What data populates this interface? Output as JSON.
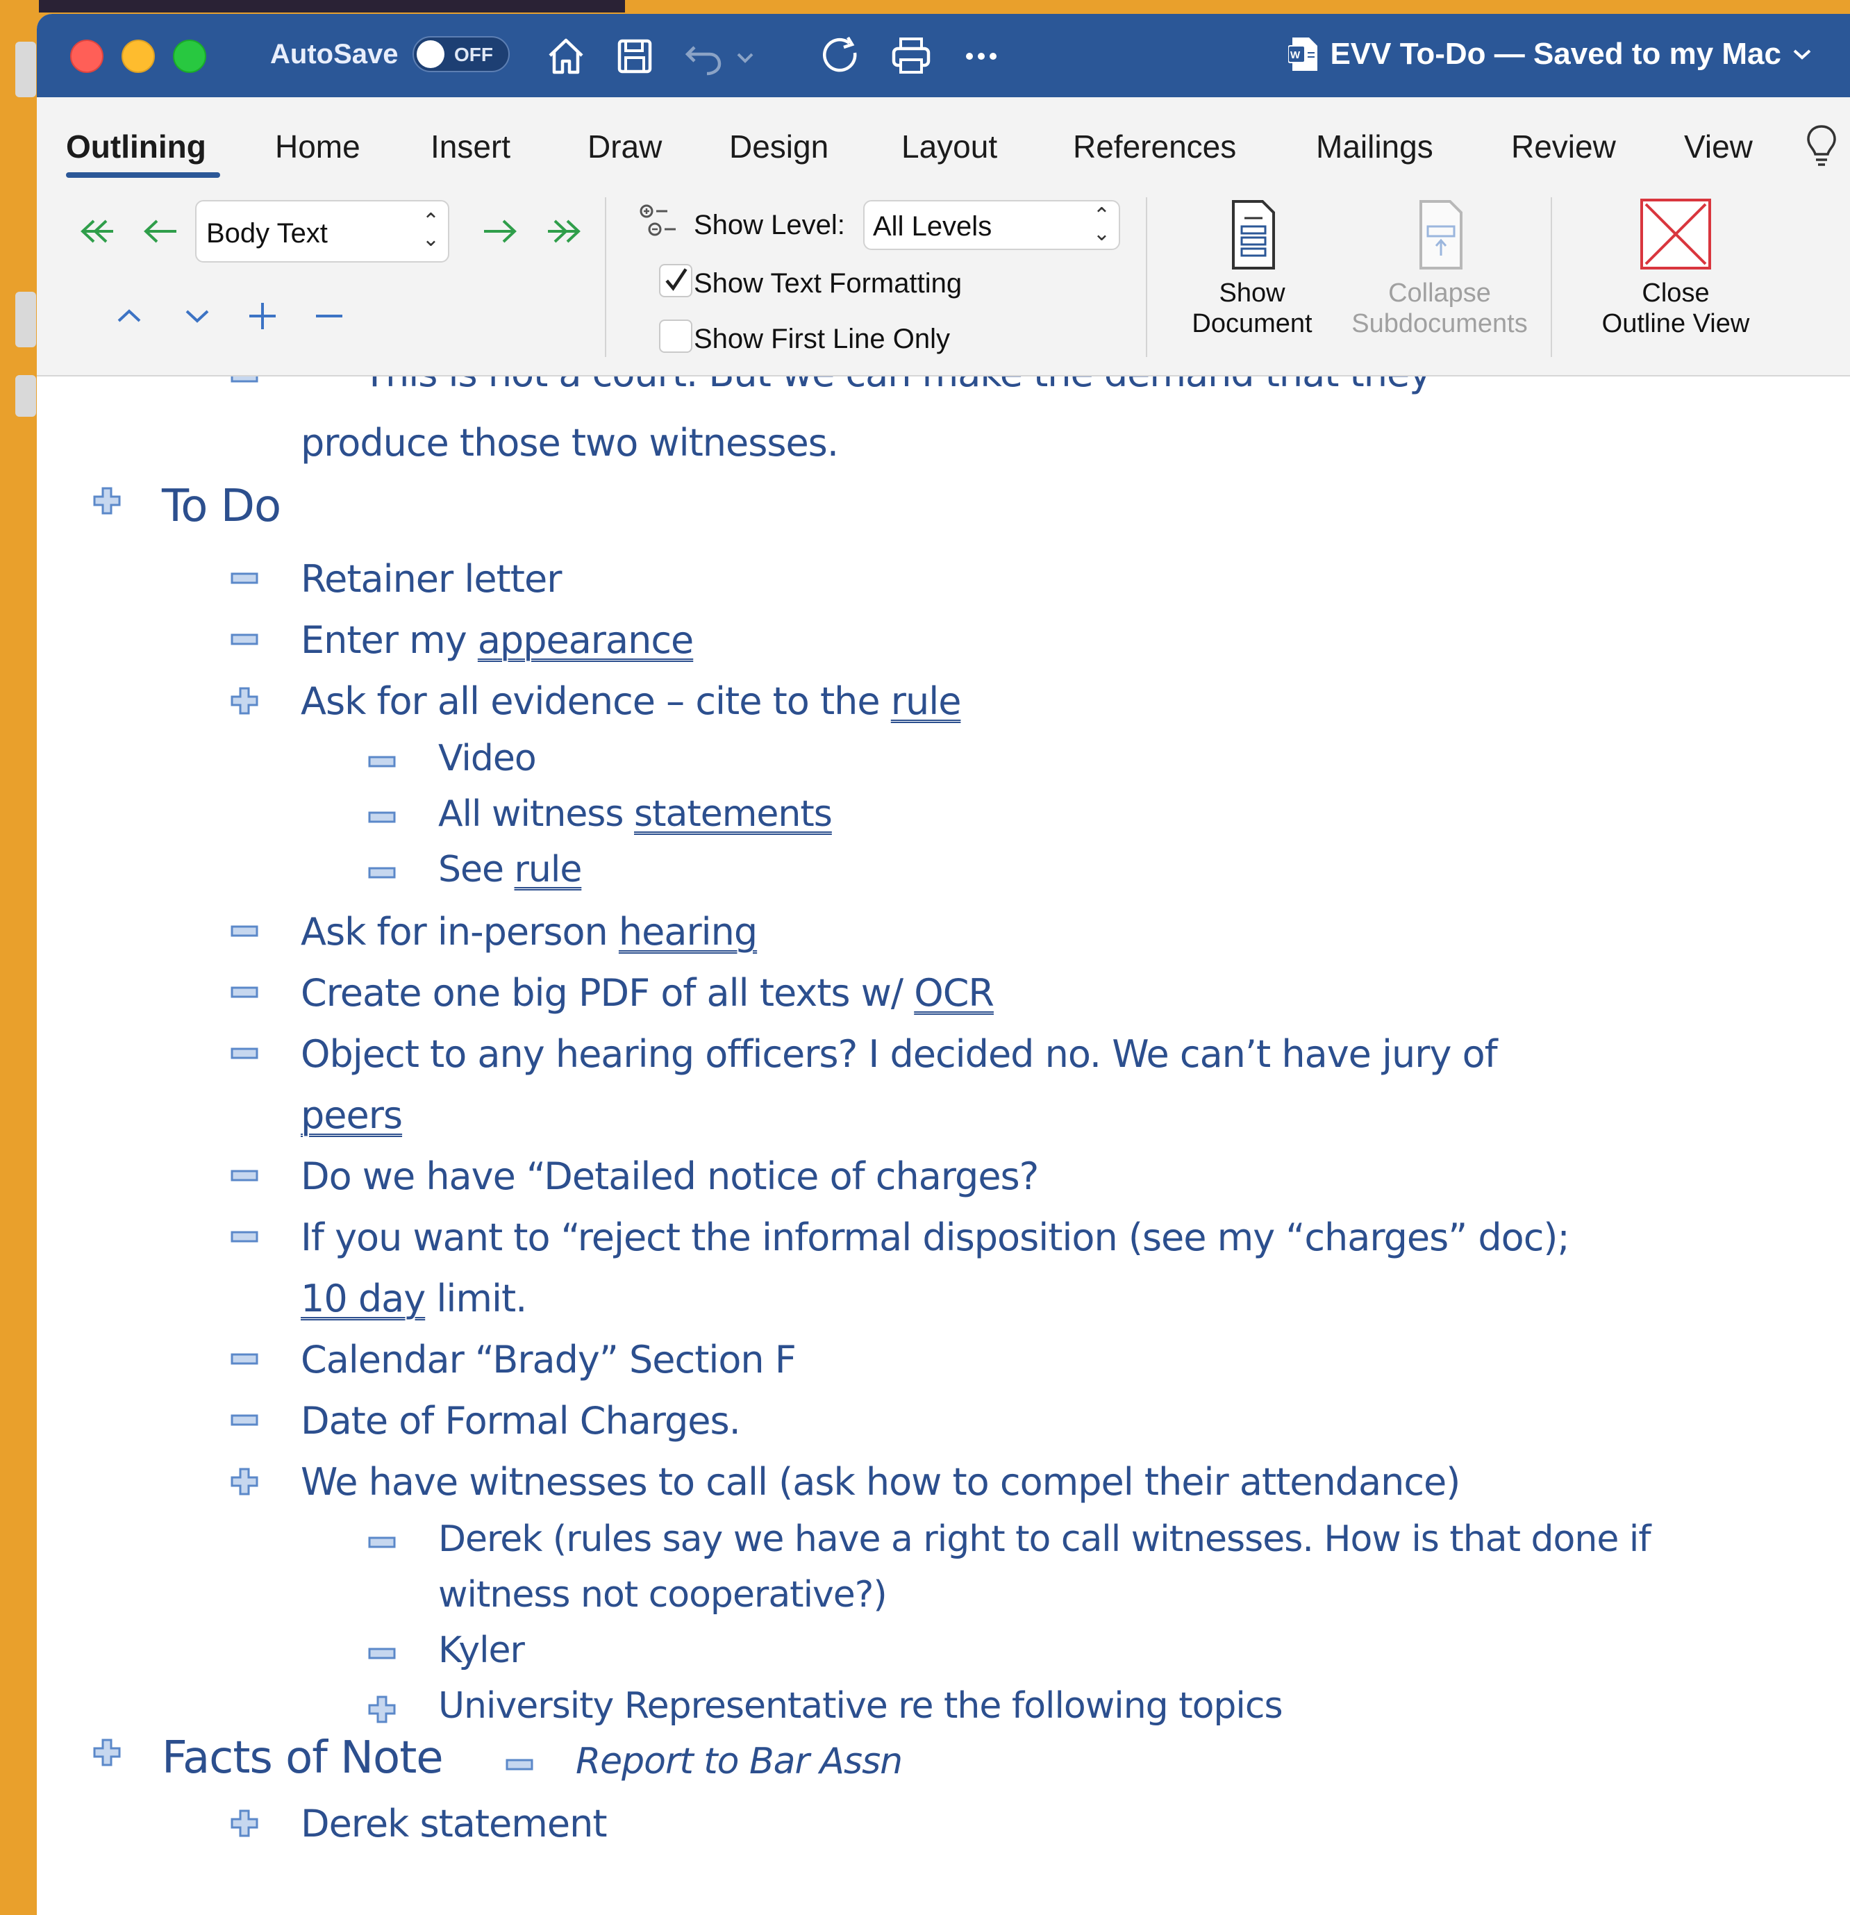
{
  "window": {
    "autosave_label": "AutoSave",
    "autosave_state": "OFF",
    "title": "EVV To-Do — Saved to my Mac",
    "title_chevron": "⌄"
  },
  "tabs": [
    "Outlining",
    "Home",
    "Insert",
    "Draw",
    "Design",
    "Layout",
    "References",
    "Mailings",
    "Review",
    "View"
  ],
  "active_tab": "Outlining",
  "ribbon": {
    "style_value": "Body Text",
    "show_level_label": "Show Level:",
    "show_level_value": "All Levels",
    "show_text_formatting": {
      "label": "Show Text Formatting",
      "checked": true
    },
    "show_first_line_only": {
      "label": "Show First Line Only",
      "checked": false
    },
    "show_document": [
      "Show",
      "Document"
    ],
    "collapse_subdocuments": [
      "Collapse",
      "Subdocuments"
    ],
    "close_outline_view": [
      "Close",
      "Outline View"
    ]
  },
  "colors": {
    "title_bar": "#2b5797",
    "outline_text": "#2c4f8e",
    "accent_green": "#2f9e4a",
    "close_red": "#d9363e"
  },
  "document": {
    "cut_line": "This is not a court.  But we can make the demand that they",
    "cont_line": "produce those two witnesses.",
    "todo_heading": "To Do",
    "items": [
      {
        "pre": "Retainer letter"
      },
      {
        "pre": "Enter my ",
        "link": "appearance"
      },
      {
        "pre": "Ask for all evidence – cite to the ",
        "link": "rule"
      },
      {
        "pre": "Video"
      },
      {
        "pre": "All witness ",
        "link": "statements"
      },
      {
        "pre": "See ",
        "link": "rule"
      },
      {
        "pre": "Ask for in-person ",
        "link": "hearing"
      },
      {
        "pre": "Create one big PDF of all texts w/ ",
        "link": "OCR"
      },
      {
        "pre": "Object to any hearing officers?  I decided no.  We can’t have jury of"
      },
      {
        "link": "peers"
      },
      {
        "pre": "Do we have “Detailed notice of charges?"
      },
      {
        "pre": "If you want to “reject the informal disposition (see my “charges” doc);"
      },
      {
        "link": "10 day",
        "post": " limit."
      },
      {
        "pre": "Calendar “Brady” Section F"
      },
      {
        "pre": "Date of Formal Charges."
      },
      {
        "pre": "We have witnesses to call (ask how to compel their attendance)"
      },
      {
        "pre": "Derek (rules say we have a right to call witnesses.  How is that done if"
      },
      {
        "pre": "witness not cooperative?)"
      },
      {
        "pre": "Kyler"
      },
      {
        "pre": "University Representative re the following topics"
      },
      {
        "pre": "Report to Bar Assn"
      }
    ],
    "facts_heading": "Facts of Note",
    "facts_item": "Derek statement"
  }
}
